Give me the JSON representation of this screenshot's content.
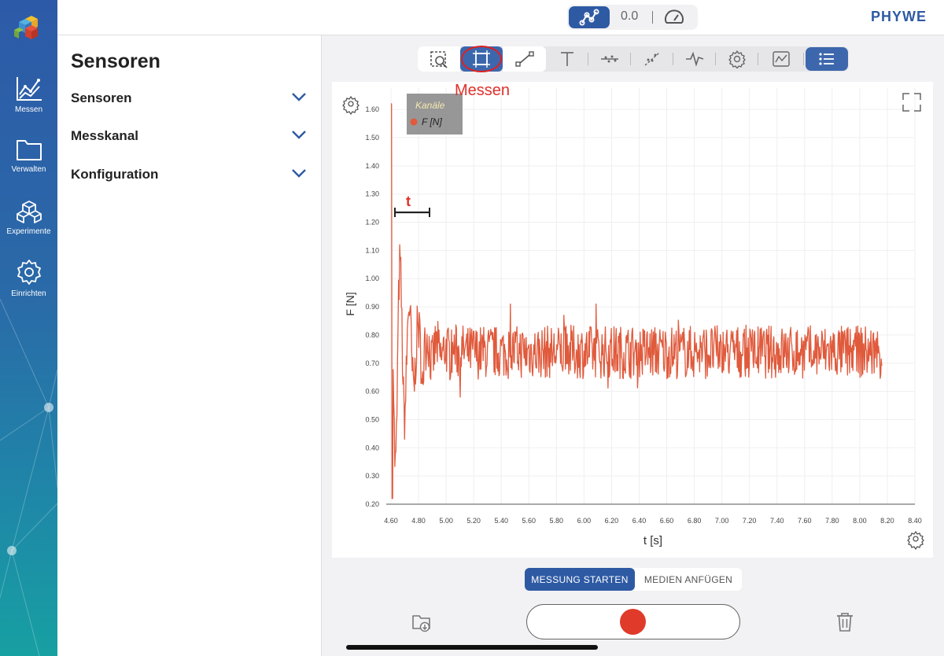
{
  "rail": {
    "items": [
      {
        "label": "Messen",
        "icon": "line-chart-icon"
      },
      {
        "label": "Verwalten",
        "icon": "folder-icon"
      },
      {
        "label": "Experimente",
        "icon": "cubes-icon"
      },
      {
        "label": "Einrichten",
        "icon": "gear-icon"
      }
    ]
  },
  "sidebar": {
    "title": "Sensoren",
    "sections": [
      {
        "label": "Sensoren"
      },
      {
        "label": "Messkanal"
      },
      {
        "label": "Konfiguration"
      }
    ]
  },
  "topbar": {
    "mode_value": "0.0",
    "brand": "PHYWE"
  },
  "toolbar": {
    "tools": [
      "zoom-region-icon",
      "measure-region-icon",
      "line-tool-icon",
      "text-tool-icon",
      "smooth-icon",
      "regression-icon",
      "signal-icon",
      "settings-icon",
      "derivative-icon",
      "list-icon"
    ],
    "active": "list-icon",
    "highlighted": "measure-region-icon"
  },
  "annotations": {
    "messen": "Messen",
    "t_marker": "t"
  },
  "chart_data": {
    "type": "line",
    "legend_title": "Kanäle",
    "series": [
      {
        "name": "F [N]",
        "color": "#e05a3c"
      }
    ],
    "xlabel": "t [s]",
    "ylabel": "F [N]",
    "xlim": [
      4.6,
      8.4
    ],
    "ylim": [
      0.2,
      1.62
    ],
    "x_ticks": [
      "4.60",
      "4.80",
      "5.00",
      "5.20",
      "5.40",
      "5.60",
      "5.80",
      "6.00",
      "6.20",
      "6.40",
      "6.60",
      "6.80",
      "7.00",
      "7.20",
      "7.40",
      "7.60",
      "7.80",
      "8.00",
      "8.20",
      "8.40"
    ],
    "y_ticks": [
      "0.20",
      "0.30",
      "0.40",
      "0.50",
      "0.60",
      "0.70",
      "0.80",
      "0.90",
      "1.00",
      "1.10",
      "1.20",
      "1.30",
      "1.40",
      "1.50",
      "1.60"
    ],
    "grid": true,
    "legend_position": "top-left",
    "shape": {
      "spike_at": 4.6,
      "spike_value": 1.62,
      "settle_value": 0.74,
      "noise_min": 0.58,
      "noise_max": 0.91,
      "end_x": 8.16
    }
  },
  "bottom": {
    "start_label": "MESSUNG STARTEN",
    "media_label": "MEDIEN ANFÜGEN"
  }
}
